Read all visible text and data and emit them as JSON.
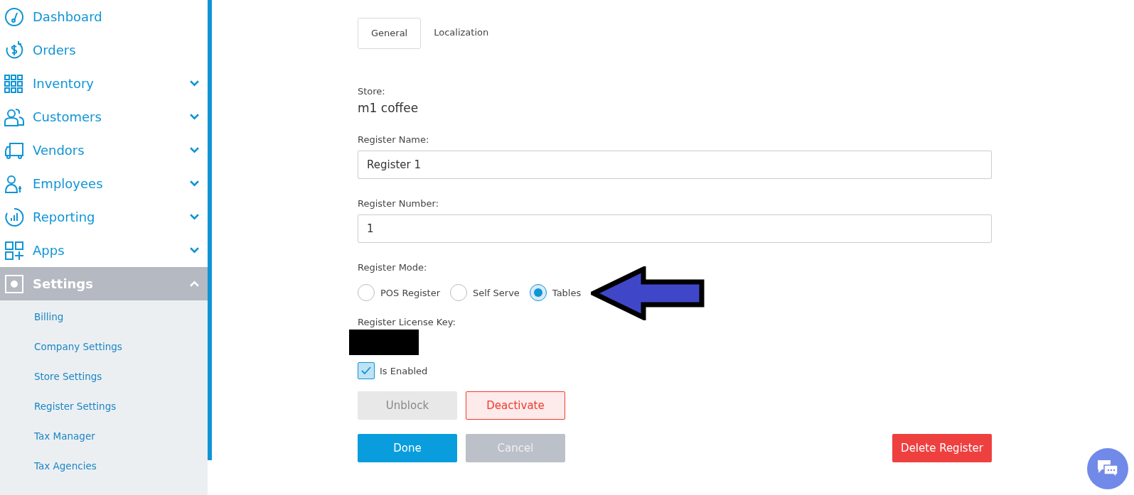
{
  "sidebar": {
    "items": [
      {
        "label": "Dashboard",
        "kind": "link",
        "selected": false
      },
      {
        "label": "Orders",
        "kind": "link",
        "selected": false
      },
      {
        "label": "Inventory",
        "kind": "group",
        "selected": false,
        "expanded": false
      },
      {
        "label": "Customers",
        "kind": "group",
        "selected": false,
        "expanded": false
      },
      {
        "label": "Vendors",
        "kind": "group",
        "selected": false,
        "expanded": false
      },
      {
        "label": "Employees",
        "kind": "group",
        "selected": false,
        "expanded": false
      },
      {
        "label": "Reporting",
        "kind": "group",
        "selected": false,
        "expanded": false
      },
      {
        "label": "Apps",
        "kind": "group",
        "selected": false,
        "expanded": false
      },
      {
        "label": "Settings",
        "kind": "group",
        "selected": true,
        "expanded": true,
        "children": [
          {
            "label": "Billing"
          },
          {
            "label": "Company Settings"
          },
          {
            "label": "Store Settings"
          },
          {
            "label": "Register Settings"
          },
          {
            "label": "Tax Manager"
          },
          {
            "label": "Tax Agencies"
          }
        ]
      }
    ]
  },
  "tabs": [
    {
      "label": "General",
      "selected": true
    },
    {
      "label": "Localization",
      "selected": false
    }
  ],
  "form": {
    "store": {
      "label": "Store:",
      "value": "m1 coffee"
    },
    "fields": [
      {
        "label": "Register Name:",
        "value": "Register 1"
      },
      {
        "label": "Register Number:",
        "value": "1"
      }
    ],
    "register_mode": {
      "label": "Register Mode:",
      "options": [
        {
          "label": "POS Register",
          "selected": false
        },
        {
          "label": "Self Serve",
          "selected": false
        },
        {
          "label": "Tables",
          "selected": true
        }
      ]
    },
    "license_key": {
      "label": "Register License Key:"
    },
    "is_enabled": {
      "label": "Is Enabled",
      "checked": true
    },
    "actions": [
      {
        "label": "Unblock",
        "kind": "muted"
      },
      {
        "label": "Deactivate",
        "kind": "danger-outline"
      }
    ],
    "buttons": [
      {
        "label": "Done",
        "kind": "primary"
      },
      {
        "label": "Cancel",
        "kind": "secondary"
      },
      {
        "label": "Delete Register",
        "kind": "danger"
      }
    ]
  }
}
